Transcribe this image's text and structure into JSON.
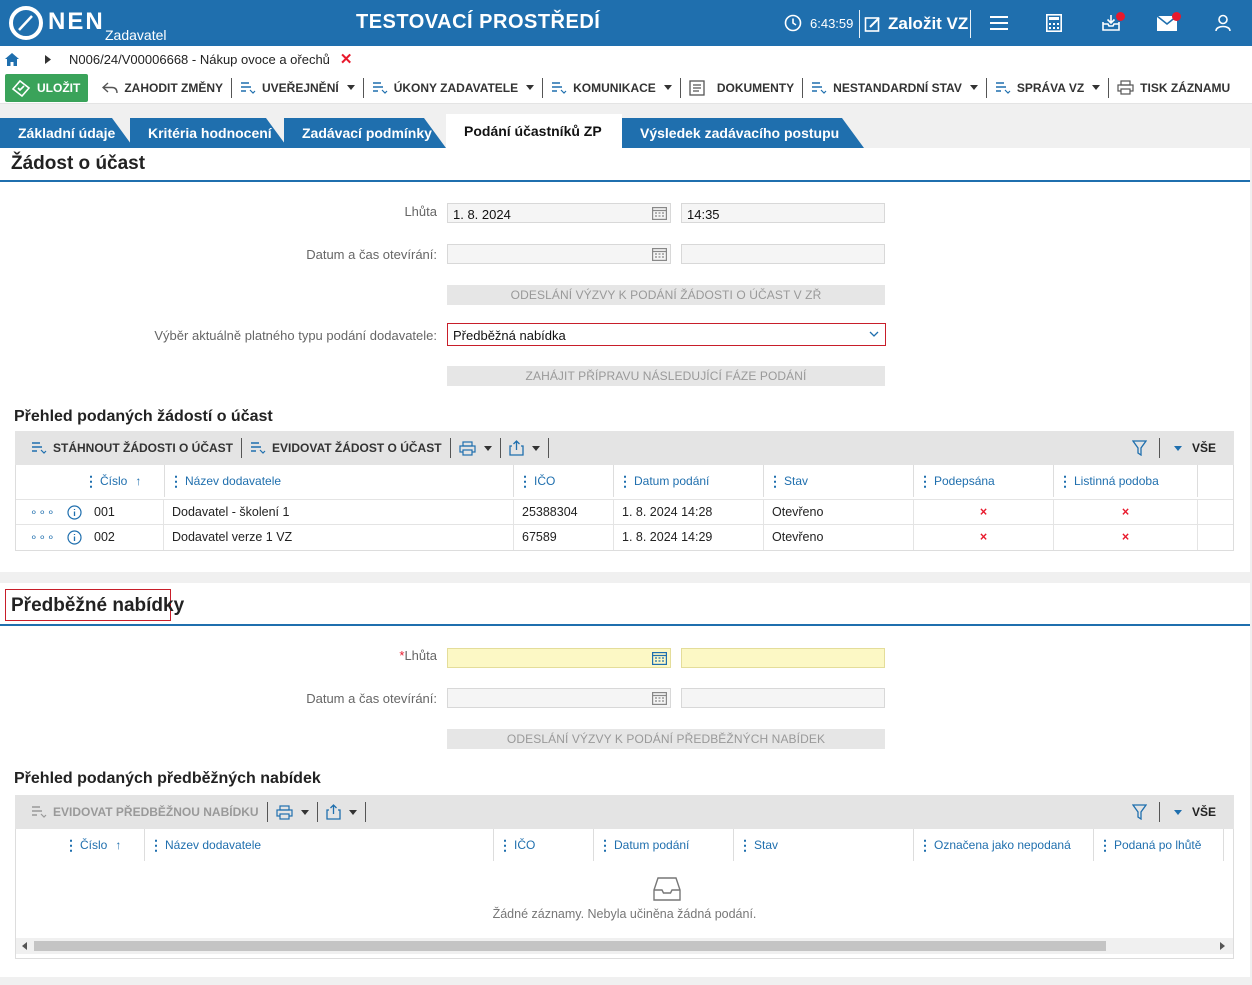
{
  "header": {
    "logo_text": "NEN",
    "logo_sub": "Zadavatel",
    "env_title": "TESTOVACÍ PROSTŘEDÍ",
    "clock": "6:43:59",
    "create_label": "Založit VZ"
  },
  "breadcrumb": {
    "text": "N006/24/V00006668 - Nákup ovoce a ořechů"
  },
  "toolbar": {
    "save": "ULOŽIT",
    "discard": "ZAHODIT ZMĚNY",
    "publish": "UVEŘEJNĚNÍ",
    "actions": "ÚKONY ZADAVATELE",
    "communication": "KOMUNIKACE",
    "documents": "DOKUMENTY",
    "nonstandard": "NESTANDARDNÍ STAV",
    "management": "SPRÁVA VZ",
    "print": "TISK ZÁZNAMU"
  },
  "tabs": [
    {
      "label": "Základní údaje"
    },
    {
      "label": "Kritéria hodnocení"
    },
    {
      "label": "Zadávací podmínky"
    },
    {
      "label": "Podání účastníků ZP",
      "active": true
    },
    {
      "label": "Výsledek zadávacího postupu"
    }
  ],
  "section1": {
    "title": "Žádost o účast",
    "deadline_label": "Lhůta",
    "deadline_date": "1. 8. 2024",
    "deadline_time": "14:35",
    "opening_label": "Datum a čas otevírání:",
    "send_call_btn": "ODESLÁNÍ VÝZVY K PODÁNÍ ŽÁDOSTI O ÚČAST V ZŘ",
    "type_label": "Výběr aktuálně platného typu podání dodavatele:",
    "type_value": "Předběžná nabídka",
    "next_phase_btn": "ZAHÁJIT PŘÍPRAVU NÁSLEDUJÍCÍ FÁZE PODÁNÍ",
    "overview_title": "Přehled podaných žádostí o účast",
    "grid_bar": {
      "download": "STÁHNOUT ŽÁDOSTI O ÚČAST",
      "record": "EVIDOVAT ŽÁDOST O ÚČAST",
      "all": "VŠE"
    },
    "columns": [
      "Číslo",
      "Název dodavatele",
      "IČO",
      "Datum podání",
      "Stav",
      "Podepsána",
      "Listinná podoba"
    ],
    "rows": [
      {
        "cislo": "001",
        "nazev": "Dodavatel - školení 1",
        "ico": "25388304",
        "datum": "1. 8. 2024 14:28",
        "stav": "Otevřeno",
        "podepsana": "×",
        "listinna": "×"
      },
      {
        "cislo": "002",
        "nazev": "Dodavatel verze 1 VZ",
        "ico": "67589",
        "datum": "1. 8. 2024 14:29",
        "stav": "Otevřeno",
        "podepsana": "×",
        "listinna": "×"
      }
    ]
  },
  "section2": {
    "title": "Předběžné nabídky",
    "req_mark": "*",
    "deadline_label": "Lhůta",
    "deadline_date": "",
    "deadline_time": "",
    "opening_label": "Datum a čas otevírání:",
    "send_call_btn": "ODESLÁNÍ VÝZVY K PODÁNÍ PŘEDBĚŽNÝCH NABÍDEK",
    "overview_title": "Přehled podaných předběžných nabídek",
    "grid_bar": {
      "record": "EVIDOVAT PŘEDBĚŽNOU NABÍDKU",
      "all": "VŠE"
    },
    "columns": [
      "Číslo",
      "Název dodavatele",
      "IČO",
      "Datum podání",
      "Stav",
      "Označena jako nepodaná",
      "Podaná po lhůtě"
    ],
    "empty_text": "Žádné záznamy. Nebyla učiněna žádná podání."
  },
  "colors": {
    "brand_blue": "#1f6fae",
    "save_green": "#3aa35a",
    "error_red": "#e8192c",
    "required_yellow": "#fcf8c5"
  }
}
